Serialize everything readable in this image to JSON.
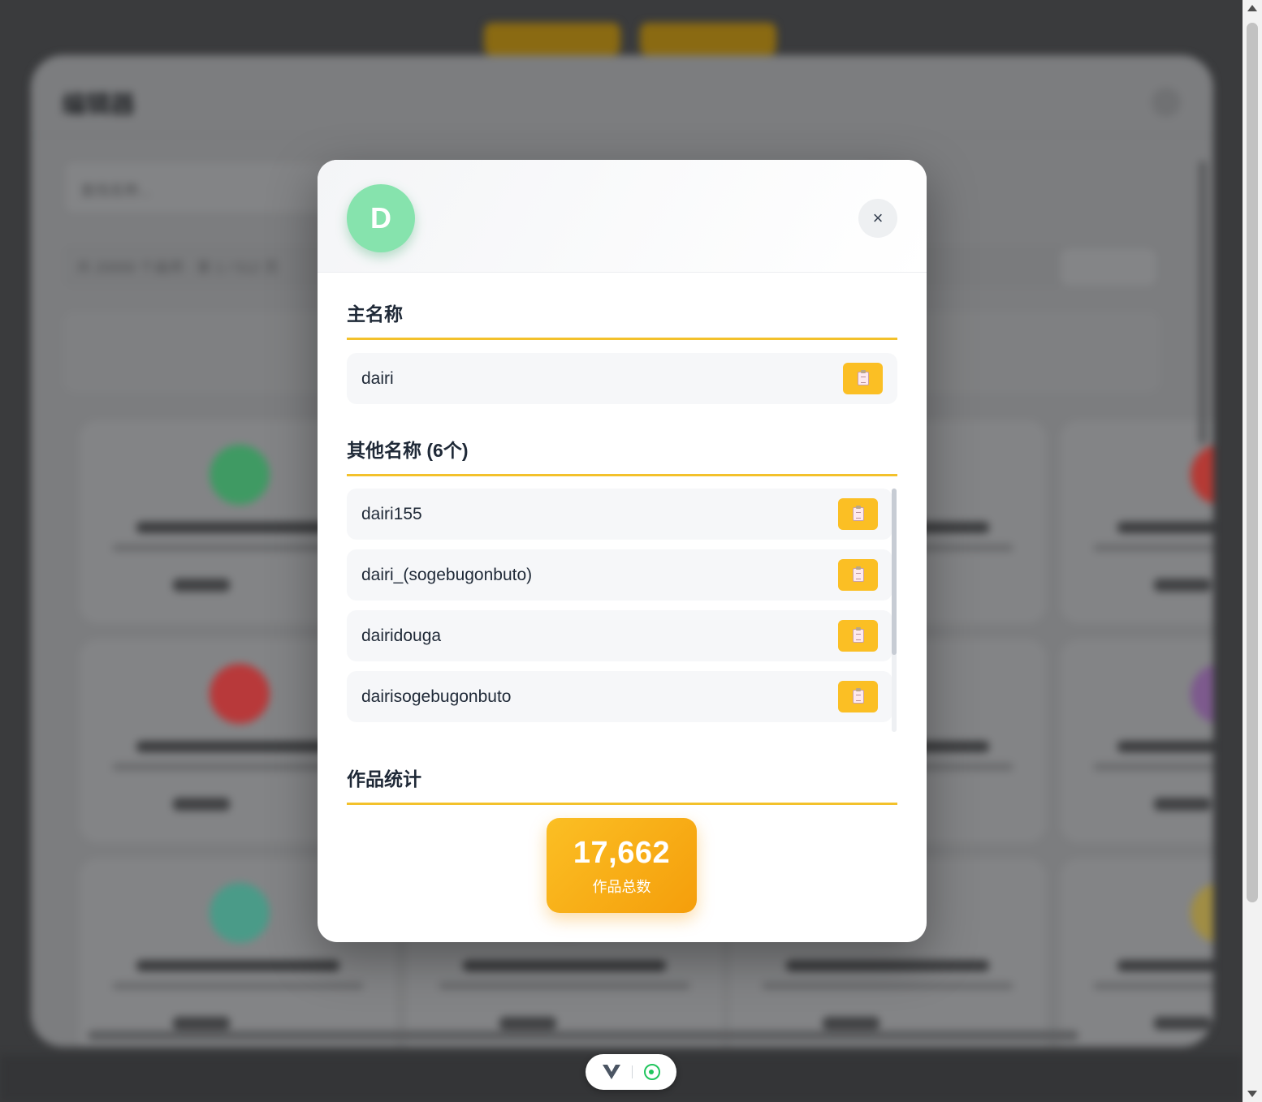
{
  "background": {
    "panel_title": "编辑器",
    "search_placeholder": "查找名称...",
    "filter_summary": "共 20000 个画师 · 第 1 / 512 页",
    "filter_button": "排序设置"
  },
  "modal": {
    "avatar_letter": "D",
    "avatar_color": "#86e3ad",
    "close_label": "×",
    "main_name_title": "主名称",
    "main_name": "dairi",
    "other_names_title": "其他名称 (6个)",
    "other_names": [
      "dairi155",
      "dairi_(sogebugonbuto)",
      "dairidouga",
      "dairisogebugonbuto"
    ],
    "stats_title": "作品统计",
    "total_works": "17,662",
    "total_works_label": "作品总数",
    "accent_color": "#f3c12b",
    "copy_icon": "clipboard-icon"
  },
  "dev_toolbar": {
    "icons": [
      "vue-icon",
      "target-icon"
    ]
  }
}
